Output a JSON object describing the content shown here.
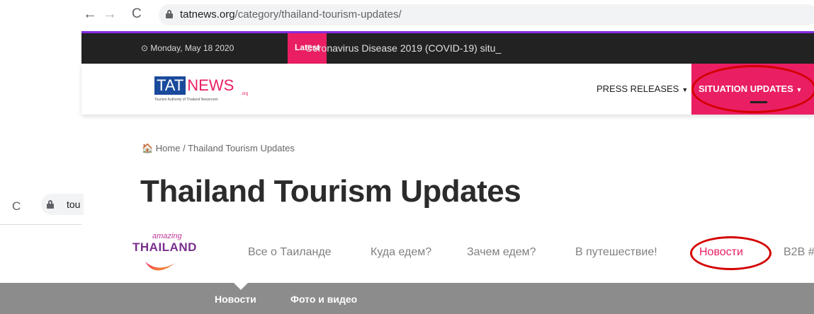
{
  "browser": {
    "url_domain": "tatnews.org",
    "url_path": "/category/thailand-tourism-updates/",
    "back_glyph": "←",
    "forward_glyph": "→",
    "reload_glyph": "C"
  },
  "topbar": {
    "date": "⊙ Monday, May 18 2020",
    "latest_label": "Latest",
    "ticker": "Coronavirus Disease 2019 (COVID-19) situ_"
  },
  "header": {
    "logo_tat": "TAT",
    "logo_news": "NEWS",
    "logo_org": ".org",
    "logo_tagline": "Tourism Authority of Thailand Newsroom",
    "press_releases": "PRESS RELEASES",
    "situation_updates": "SITUATION UPDATES",
    "caret": "▼"
  },
  "breadcrumb": "🏠 Home / Thailand Tourism Updates",
  "page_title": "Thailand Tourism Updates",
  "browser2": {
    "reload_glyph": "C",
    "url_fragment": "tou"
  },
  "amazing_thailand": {
    "logo_amazing": "amazing",
    "logo_thailand": "THAILAND",
    "menu": [
      "Все о Таиланде",
      "Куда едем?",
      "Зачем едем?",
      "В путешествие!",
      "Новости",
      "B2B #"
    ],
    "subnav": [
      "Новости",
      "Фото и видео"
    ]
  },
  "colors": {
    "accent_pink": "#e91e63",
    "annotation_red": "#d40000",
    "tat_blue": "#1a4a9c"
  }
}
